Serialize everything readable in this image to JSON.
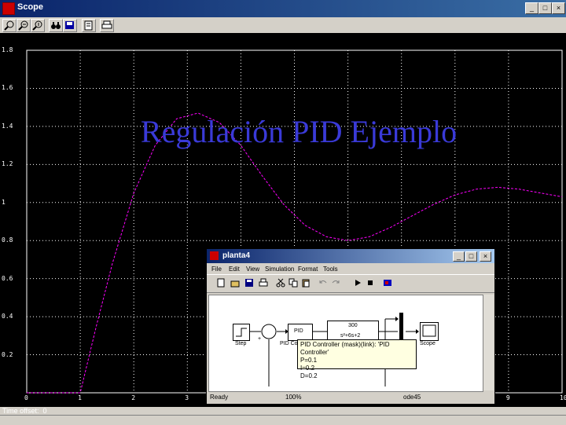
{
  "scope_window": {
    "title": "Scope",
    "controls": [
      "_",
      "□",
      "×"
    ]
  },
  "plot": {
    "y_ticks": [
      "1.8",
      "1.6",
      "1.4",
      "1.2",
      "1",
      "0.8",
      "0.6",
      "0.4",
      "0.2"
    ],
    "x_ticks": [
      "0",
      "1",
      "2",
      "3",
      "4",
      "5",
      "6",
      "7",
      "8",
      "9",
      "10"
    ],
    "time_offset_label": "Time offset:",
    "time_offset_value": "0",
    "line_color": "#ff00ff"
  },
  "chart_data": {
    "type": "line",
    "xlim": [
      0,
      10
    ],
    "ylim": [
      0,
      1.8
    ],
    "grid": true,
    "series": [
      {
        "x": [
          0,
          1,
          1.3,
          1.6,
          2,
          2.4,
          2.8,
          3.2,
          3.6,
          4,
          4.4,
          4.8,
          5.2,
          5.6,
          6,
          6.4,
          6.8,
          7.2,
          7.6,
          8,
          8.4,
          8.8,
          9.2,
          9.6,
          10
        ],
        "y": [
          0,
          0,
          0.35,
          0.68,
          1.05,
          1.3,
          1.44,
          1.47,
          1.42,
          1.3,
          1.14,
          0.99,
          0.88,
          0.82,
          0.8,
          0.82,
          0.87,
          0.93,
          0.99,
          1.04,
          1.07,
          1.08,
          1.07,
          1.05,
          1.03
        ]
      }
    ]
  },
  "overlay_title": "Regulación PID Ejemplo",
  "simulink": {
    "title": "planta4",
    "menu": [
      "File",
      "Edit",
      "View",
      "Simulation",
      "Format",
      "Tools"
    ],
    "blocks": {
      "step": "Step",
      "pid": "PID",
      "pid_caption": "PID Co",
      "plant_num": "300",
      "plant_den": "s²+6s+2",
      "scope": "Scope",
      "sum_sign": "+"
    },
    "tooltip": {
      "line1": "PID Controller (mask)(link): 'PID Controller'",
      "line2": "P=0.1",
      "line3": "I=0.2",
      "line4": "D=0.2"
    },
    "status": {
      "ready": "Ready",
      "zoom": "100%",
      "solver": "ode45"
    }
  }
}
